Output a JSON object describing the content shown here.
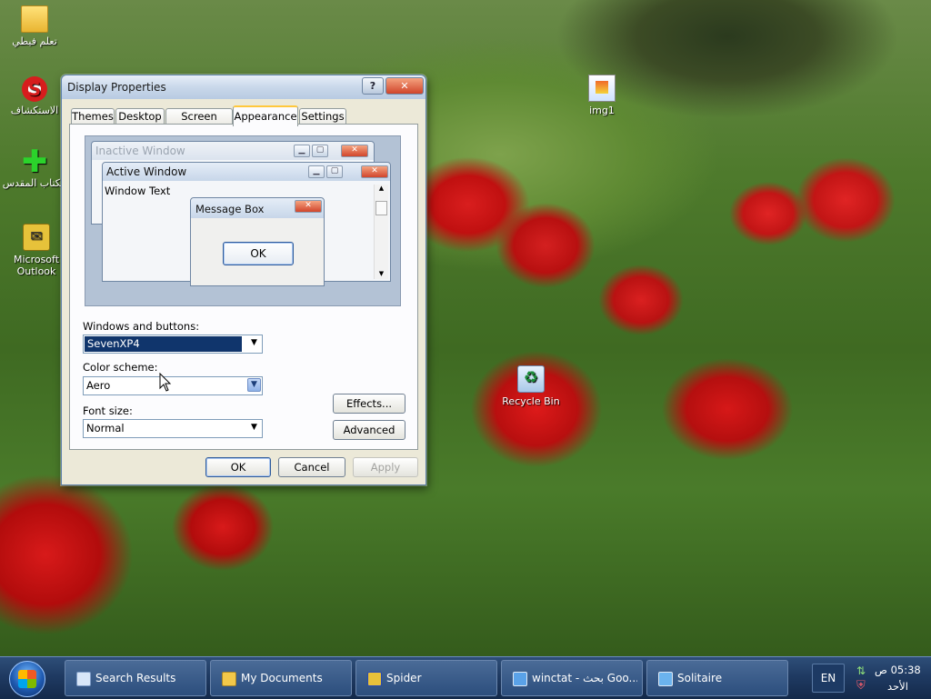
{
  "desktop": {
    "icons": [
      {
        "label": "تعلم فيطي"
      },
      {
        "label": "الاستكشاف"
      },
      {
        "label": "الكتاب المقدس"
      },
      {
        "label": "Microsoft Outlook"
      },
      {
        "label": "img1"
      },
      {
        "label": "Recycle Bin"
      }
    ]
  },
  "window": {
    "title": "Display Properties",
    "help_label": "?",
    "close_label": "✕",
    "tabs": [
      {
        "label": "Themes"
      },
      {
        "label": "Desktop"
      },
      {
        "label": "Screen Saver"
      },
      {
        "label": "Appearance"
      },
      {
        "label": "Settings"
      }
    ],
    "preview": {
      "inactive_title": "Inactive Window",
      "active_title": "Active Window",
      "window_text": "Window Text",
      "message_title": "Message Box",
      "message_ok": "OK"
    },
    "windows_buttons": {
      "label": "Windows and buttons:",
      "value": "SevenXP4"
    },
    "color_scheme": {
      "label": "Color scheme:",
      "value": "Aero"
    },
    "font_size": {
      "label": "Font size:",
      "value": "Normal"
    },
    "effects_label": "Effects...",
    "advanced_label": "Advanced",
    "ok_label": "OK",
    "cancel_label": "Cancel",
    "apply_label": "Apply"
  },
  "taskbar": {
    "buttons": [
      {
        "label": "Search Results",
        "icon": "search-results-icon",
        "color": "#d8e6f8"
      },
      {
        "label": "My Documents",
        "icon": "folder-icon",
        "color": "#f2c84a"
      },
      {
        "label": "Spider",
        "icon": "spider-icon",
        "color": "#e8c13a"
      },
      {
        "label": "winctat - بحث Goo...",
        "icon": "ie-icon",
        "color": "#5aa2e8"
      },
      {
        "label": "Solitaire",
        "icon": "solitaire-icon",
        "color": "#6bb3ee"
      }
    ],
    "language": "EN",
    "time": "05:38 ص",
    "day": "الأحد"
  }
}
